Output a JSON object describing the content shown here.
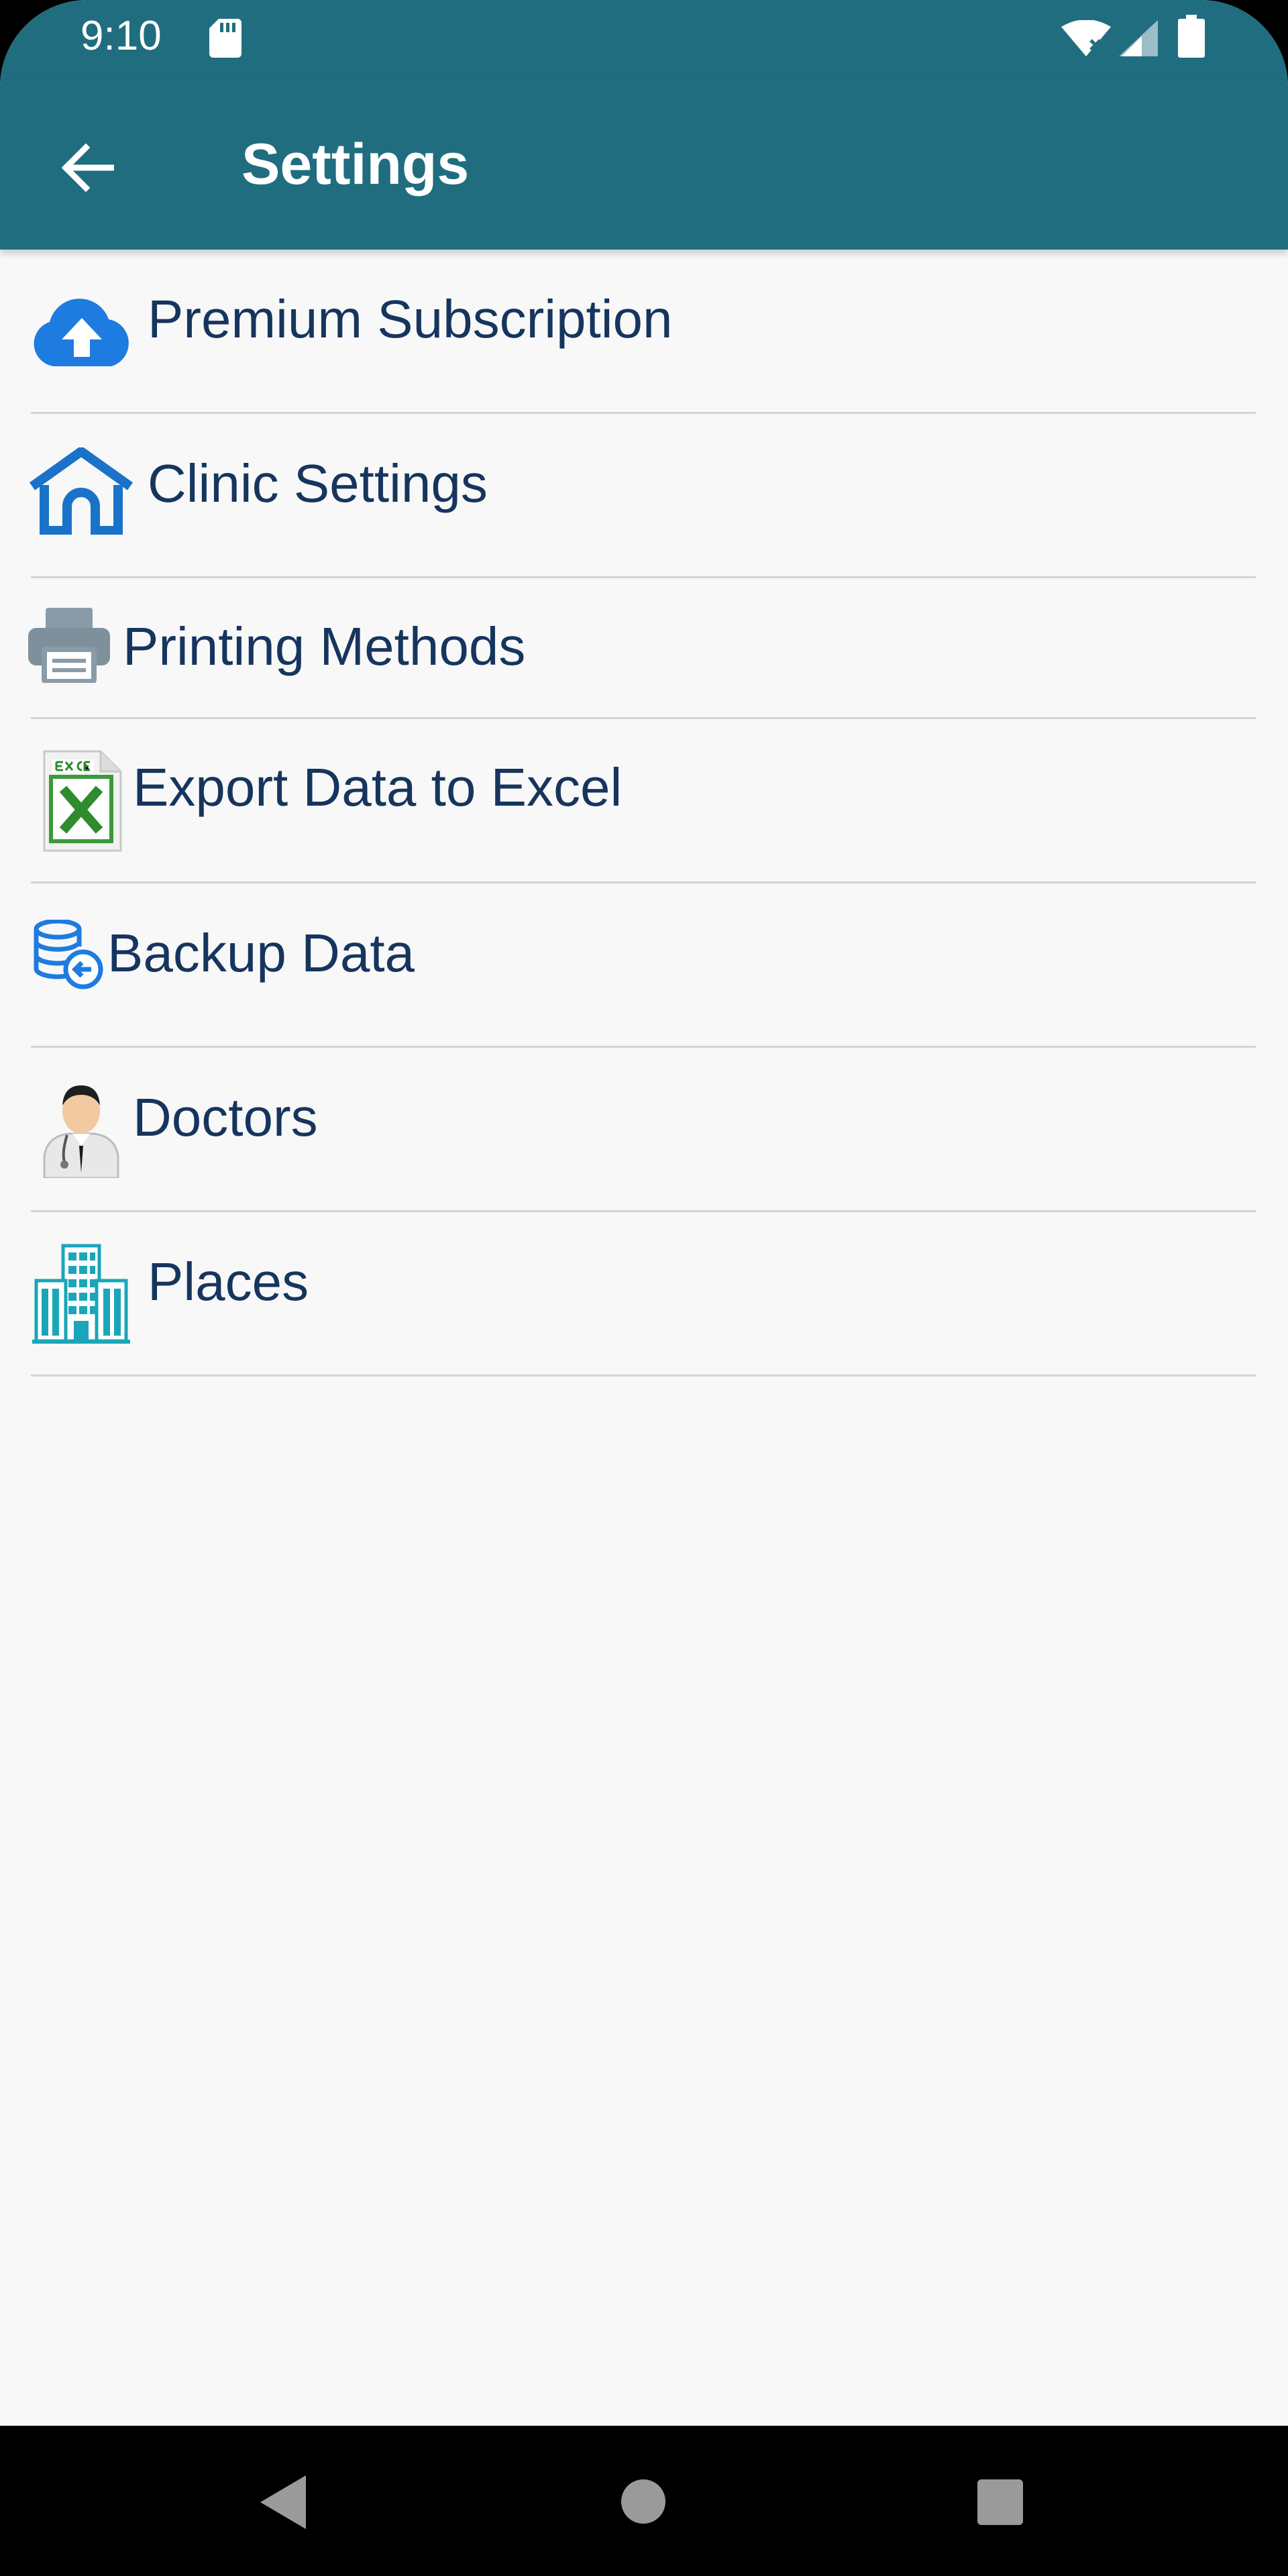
{
  "status_bar": {
    "time": "9:10"
  },
  "app_bar": {
    "title": "Settings",
    "back_icon": "arrow-left-icon"
  },
  "settings": {
    "items": [
      {
        "label": "Premium Subscription",
        "icon": "cloud-upload-icon"
      },
      {
        "label": "Clinic Settings",
        "icon": "house-icon"
      },
      {
        "label": "Printing Methods",
        "icon": "printer-icon"
      },
      {
        "label": "Export Data to Excel",
        "icon": "excel-file-icon"
      },
      {
        "label": "Backup Data",
        "icon": "database-backup-icon"
      },
      {
        "label": "Doctors",
        "icon": "doctor-icon"
      },
      {
        "label": "Places",
        "icon": "building-icon"
      }
    ]
  },
  "colors": {
    "app_bar": "#206d80",
    "text_primary": "#16355e",
    "accent_blue": "#1e7be0",
    "divider": "#d4d4d4",
    "background": "#f8f8f8"
  }
}
